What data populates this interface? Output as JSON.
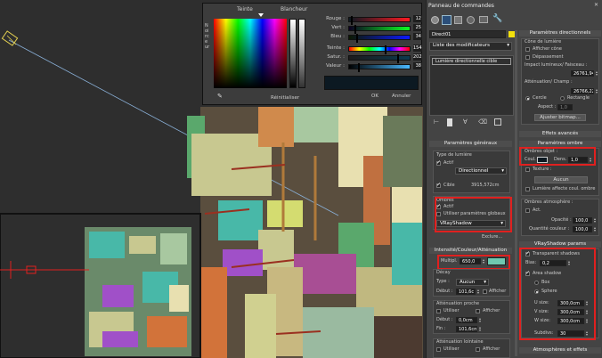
{
  "color_picker": {
    "hue_label": "Teinte",
    "white_label": "Blancheur",
    "blackness_label": "Noirceur",
    "sliders": [
      {
        "label": "Rouge :",
        "value": "12"
      },
      {
        "label": "Vert :",
        "value": "25"
      },
      {
        "label": "Bleu :",
        "value": "34"
      },
      {
        "label": "Teinte :",
        "value": "154"
      },
      {
        "label": "Satur. :",
        "value": "202"
      },
      {
        "label": "Valeur :",
        "value": "38"
      }
    ],
    "reset_label": "Réinitialiser",
    "ok_label": "OK",
    "cancel_label": "Annuler",
    "swatch_color": "#0c1922"
  },
  "panel": {
    "title": "Panneau de commandes",
    "object_name": "Direct01",
    "modifier_list": "Liste des modificateurs",
    "stack_item": "Lumière directionnelle cible",
    "gen": {
      "title": "Paramètres généraux",
      "light_type_label": "Type de lumière",
      "active_label": "Actif",
      "type_value": "Directionnel",
      "target_label": "Cible",
      "target_value": "3915,572cm",
      "shadows_label": "Ombres",
      "shadows_active": "Actif",
      "global_label": "Utiliser paramètres globaux",
      "shadow_type": "VRayShadow",
      "exclude_label": "Exclure..."
    },
    "intensity": {
      "title": "Intensité/Couleur/Atténuation",
      "multiplier_label": "Multipl.",
      "multiplier_value": "650,0",
      "decay_label": "Décay",
      "type_label": "Type :",
      "type_value": "Aucun",
      "start_label": "Début :",
      "start_value": "101,6c",
      "show_label": "Afficher"
    },
    "near": {
      "title": "Atténuation proche",
      "use_label": "Utiliser",
      "show_label": "Afficher",
      "start_label": "Début :",
      "start_value": "0,0cm",
      "end_label": "Fin :",
      "end_value": "101,6cm"
    },
    "far": {
      "title": "Atténuation lointaine",
      "use_label": "Utiliser",
      "show_label": "Afficher"
    },
    "dir": {
      "title": "Paramètres directionnels",
      "cone_label": "Cône de lumière",
      "show_cone": "Afficher cône",
      "overshoot": "Dépassement",
      "hotspot_label": "Impact lumineux/ Faisceau :",
      "hotspot_value": "26761,94",
      "falloff_label": "Atténuation/ Champ :",
      "falloff_value": "26766,22",
      "circle": "Cercle",
      "rectangle": "Rectangle",
      "aspect_label": "Aspect :",
      "aspect_value": "1,0",
      "bitmap_button": "Ajuster bitmap..."
    },
    "adv": {
      "title": "Effets avancés"
    },
    "shadow": {
      "title": "Paramètres ombre",
      "object_shadows": "Ombres objet :",
      "color_label": "Coul.",
      "density_label": "Dens.",
      "density_value": "1,0",
      "texture_label": "Texture :",
      "none_button": "Aucun",
      "affect_label": "Lumière affecte coul. ombre",
      "atmo_label": "Ombres atmosphère :",
      "act_label": "Act.",
      "opacity_label": "Opacité :",
      "opacity_value": "100,0",
      "qty_label": "Quantité couleur :",
      "qty_value": "100,0"
    },
    "vray": {
      "title": "VRayShadow params",
      "transparent": "Transparent shadows",
      "bias_label": "Bias:",
      "bias_value": "0,2",
      "area": "Area shadow",
      "box": "Box",
      "sphere": "Sphere",
      "u_label": "U size:",
      "u_value": "300,0cm",
      "v_label": "V size:",
      "v_value": "300,0cm",
      "w_label": "W size:",
      "w_value": "300,0cm",
      "subdivs_label": "Subdivs:",
      "subdivs_value": "30"
    },
    "atmo": {
      "title": "Atmosphères et effets"
    }
  }
}
